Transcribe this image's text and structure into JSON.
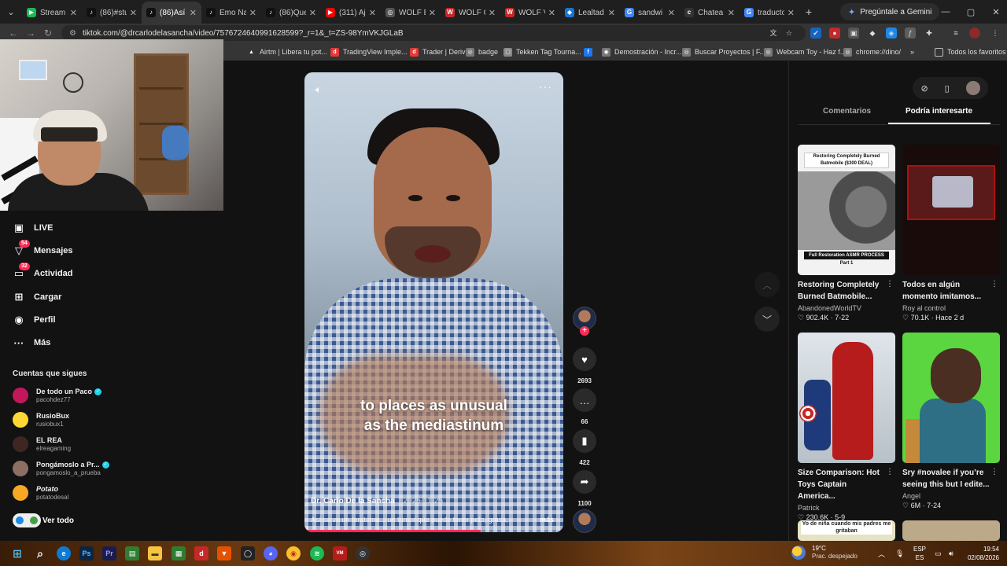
{
  "browser": {
    "tabs": [
      {
        "title": "Stream",
        "fav_color": "#1db954",
        "fav_glyph": "▶",
        "active": false
      },
      {
        "title": "(86)#stu",
        "fav_color": "#111111",
        "fav_glyph": "♪",
        "active": false
      },
      {
        "title": "(86)Así",
        "fav_color": "#111111",
        "fav_glyph": "♪",
        "active": true
      },
      {
        "title": "Emo Na",
        "fav_color": "#111111",
        "fav_glyph": "♪",
        "active": false
      },
      {
        "title": "(86)Que",
        "fav_color": "#111111",
        "fav_glyph": "♪",
        "active": false
      },
      {
        "title": "(311) Aj",
        "fav_color": "#ff0000",
        "fav_glyph": "▶",
        "active": false
      },
      {
        "title": "WOLF B",
        "fav_color": "#555555",
        "fav_glyph": "◎",
        "active": false
      },
      {
        "title": "WOLF C",
        "fav_color": "#c62828",
        "fav_glyph": "W",
        "active": false
      },
      {
        "title": "WOLF V",
        "fav_color": "#c62828",
        "fav_glyph": "W",
        "active": false
      },
      {
        "title": "Lealtad",
        "fav_color": "#1976d2",
        "fav_glyph": "◆",
        "active": false
      },
      {
        "title": "sandwi",
        "fav_color": "#4285f4",
        "fav_glyph": "G",
        "active": false
      },
      {
        "title": "Chatea",
        "fav_color": "#333333",
        "fav_glyph": "c",
        "active": false
      },
      {
        "title": "traducto",
        "fav_color": "#4285f4",
        "fav_glyph": "G",
        "active": false
      }
    ],
    "gemini_label": "Pregúntale a Gemini",
    "url": "tiktok.com/@drcarlodelasancha/video/7576724640991628599?_r=1&_t=ZS-98YmVKJGLaB",
    "bookmarks": [
      {
        "label": "Airtm | Libera tu pot...",
        "color": "#ffffff",
        "glyph": "▲"
      },
      {
        "label": "TradingView Imple...",
        "color": "#e53935",
        "glyph": "d"
      },
      {
        "label": "Trader | Deriv",
        "color": "#e53935",
        "glyph": "d"
      },
      {
        "label": "badge",
        "color": "#777777",
        "glyph": "◎"
      },
      {
        "label": "Tekken Tag Tourna...",
        "color": "#888888",
        "glyph": "▢"
      },
      {
        "label": "",
        "color": "#1877f2",
        "glyph": "f"
      },
      {
        "label": "Demostración - Incr...",
        "color": "#777777",
        "glyph": "◉"
      },
      {
        "label": "Buscar Proyectos | F...",
        "color": "#777777",
        "glyph": "◎"
      },
      {
        "label": "Webcam Toy - Haz f...",
        "color": "#777777",
        "glyph": "◎"
      },
      {
        "label": "chrome://dino/",
        "color": "#777777",
        "glyph": "◎"
      }
    ],
    "bookmarks_more": "»",
    "all_bookmarks": "Todos los favoritos"
  },
  "sidebar": {
    "nav": [
      {
        "label": "LIVE",
        "icon": "live-icon",
        "glyph": "▣",
        "badge": ""
      },
      {
        "label": "Mensajes",
        "icon": "messages-icon",
        "glyph": "▽",
        "badge": "54"
      },
      {
        "label": "Actividad",
        "icon": "activity-icon",
        "glyph": "▭",
        "badge": "32"
      },
      {
        "label": "Cargar",
        "icon": "upload-icon",
        "glyph": "⊞",
        "badge": ""
      },
      {
        "label": "Perfil",
        "icon": "profile-icon",
        "glyph": "◉",
        "badge": ""
      },
      {
        "label": "Más",
        "icon": "more-icon",
        "glyph": "···",
        "badge": ""
      }
    ],
    "following_heading": "Cuentas que sigues",
    "accounts": [
      {
        "name": "De todo un Paco",
        "handle": "pacohdez77",
        "verified": true,
        "italic": false,
        "avatar_color": "#c2185b"
      },
      {
        "name": "RusioBux",
        "handle": "rusiobux1",
        "verified": false,
        "italic": false,
        "avatar_color": "#fdd835"
      },
      {
        "name": "EL REA",
        "handle": "elreagaming",
        "verified": false,
        "italic": false,
        "avatar_color": "#3e2723"
      },
      {
        "name": "Pongámoslo a Pr...",
        "handle": "pongamoslo_a_prueba",
        "verified": true,
        "italic": false,
        "avatar_color": "#8d6e63"
      },
      {
        "name": "Potato",
        "handle": "potatodesal",
        "verified": false,
        "italic": true,
        "avatar_color": "#f9a825"
      }
    ],
    "see_all": "Ver todo"
  },
  "video": {
    "caption_line1": "to places as unusual",
    "caption_line2": "as the mediastinum",
    "author": "Dr. Carlo De la Sancha",
    "date": "· 2025-11-25",
    "description": "Así se ve un teratoma... un tumor que puede tener pelo, grasa,",
    "more_label": "más",
    "progress": 0.68,
    "more_menu": "···"
  },
  "actions": {
    "likes": "2693",
    "comments": "66",
    "saves": "422",
    "shares": "1100"
  },
  "right_panel": {
    "tabs": [
      "Comentarios",
      "Podría interesarte"
    ],
    "active_tab": 1,
    "cards": [
      {
        "title": "Restoring Completely Burned Batmobile...",
        "author": "AbandonedWorldTV",
        "likes": "902.4K",
        "date": "7-22",
        "thumb_band": "Restoring Completely Burned Batmobile ($300 DEAL)",
        "thumb_band2": "Full Restoration ASMR PROCESS",
        "thumb_part": "Part 1"
      },
      {
        "title": "Todos en algún momento imitamos...",
        "author": "Roy al control",
        "likes": "70.1K",
        "date": "Hace 2 d"
      },
      {
        "title": "Size Comparison: Hot Toys Captain America...",
        "author": "Patrick",
        "likes": "230.6K",
        "date": "5-9"
      },
      {
        "title": "Sry #novalee if you’re seeing this but I edite...",
        "author": "Angel",
        "likes": "6M",
        "date": "7-24"
      },
      {
        "thumb_text": "Yo de niña cuando mis padres me gritaban"
      }
    ]
  },
  "taskbar": {
    "weather_temp": "19°C",
    "weather_desc": "Prac. despejado",
    "lang_top": "ESP",
    "lang_bottom": "ES",
    "time": "19:54",
    "date": "02/08/2026"
  }
}
